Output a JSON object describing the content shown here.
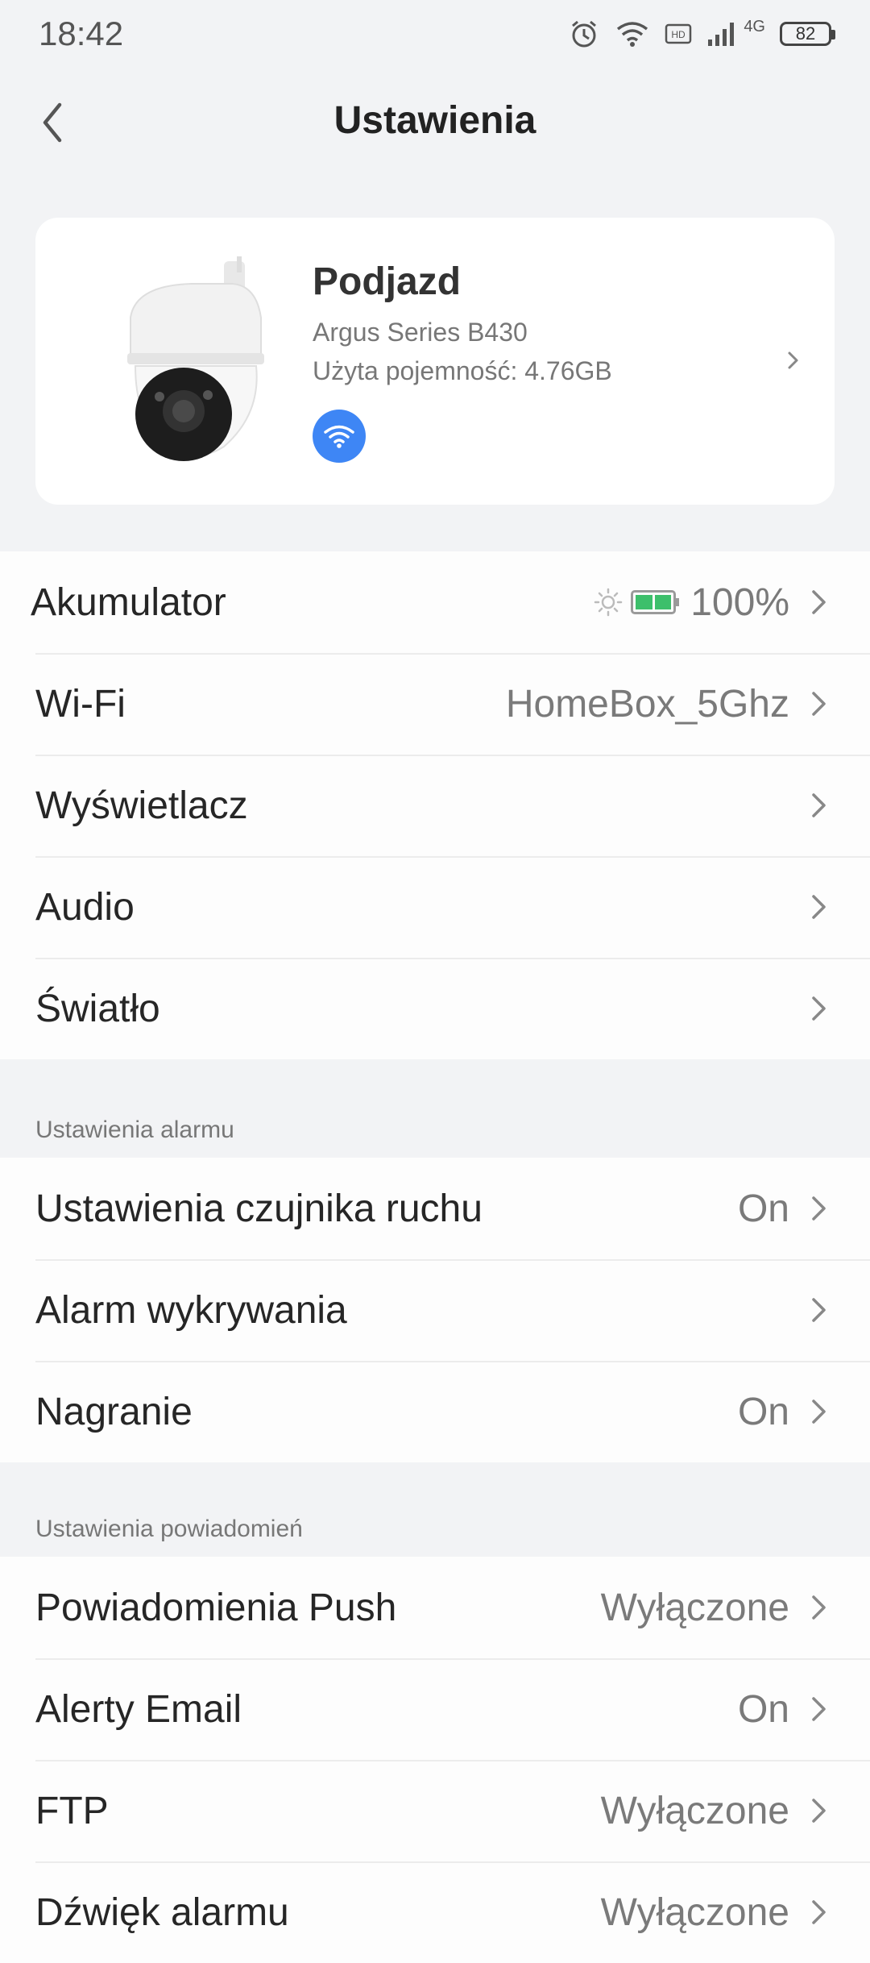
{
  "status_bar": {
    "time": "18:42",
    "battery_level": "82",
    "network_label": "4G",
    "hd_label": "HD",
    "icons": [
      "alarm-icon",
      "wifi-icon",
      "hd-icon",
      "signal-icon",
      "battery-icon"
    ]
  },
  "header": {
    "title": "Ustawienia",
    "back_icon": "chevron-left-icon"
  },
  "device": {
    "name": "Podjazd",
    "model": "Argus Series B430",
    "storage": "Użyta pojemność: 4.76GB",
    "connection_icon": "wifi-icon",
    "accent_color": "#3e86f5"
  },
  "general": {
    "items": [
      {
        "label": "Akumulator",
        "value": "100%",
        "icons": [
          "sun-icon",
          "battery-charging-icon"
        ]
      },
      {
        "label": "Wi-Fi",
        "value": "HomeBox_5Ghz"
      },
      {
        "label": "Wyświetlacz",
        "value": ""
      },
      {
        "label": "Audio",
        "value": ""
      },
      {
        "label": "Światło",
        "value": ""
      }
    ]
  },
  "alarm": {
    "section_title": "Ustawienia alarmu",
    "items": [
      {
        "label": "Ustawienia czujnika ruchu",
        "value": "On"
      },
      {
        "label": "Alarm wykrywania",
        "value": ""
      },
      {
        "label": "Nagranie",
        "value": "On"
      }
    ]
  },
  "notifications": {
    "section_title": "Ustawienia powiadomień",
    "items": [
      {
        "label": "Powiadomienia Push",
        "value": "Wyłączone"
      },
      {
        "label": "Alerty Email",
        "value": "On"
      },
      {
        "label": "FTP",
        "value": "Wyłączone"
      },
      {
        "label": "Dźwięk alarmu",
        "value": "Wyłączone"
      }
    ]
  }
}
